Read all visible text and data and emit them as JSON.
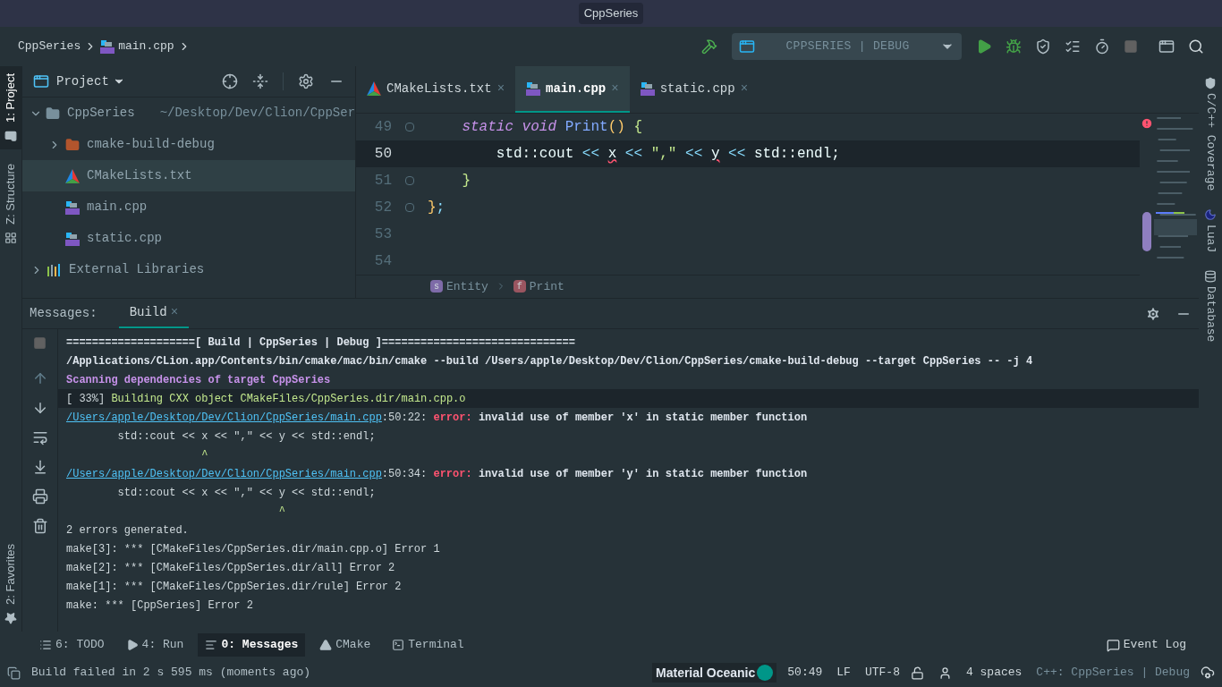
{
  "title_bar": {
    "title": "CppSeries"
  },
  "nav_bar": {
    "breadcrumbs": [
      {
        "label": "CppSeries",
        "kind": "project"
      },
      {
        "label": "main.cpp",
        "kind": "cpp"
      }
    ],
    "run_config": "CPPSERIES | DEBUG"
  },
  "left_stripe": {
    "top": [
      {
        "label": "1: Project",
        "selected": true,
        "kind": "folder"
      },
      {
        "label": "Z: Structure",
        "selected": false,
        "kind": "structure"
      }
    ],
    "bottom": [
      {
        "label": "2: Favorites",
        "selected": false,
        "kind": "star"
      }
    ]
  },
  "project_panel": {
    "title": "Project",
    "tree": [
      {
        "label": "CppSeries",
        "path": "~/Desktop/Dev/Clion/CppSer",
        "kind": "folder",
        "expanded": true,
        "selected": false,
        "children": [
          {
            "label": "cmake-build-debug",
            "kind": "build-folder",
            "expanded": false,
            "selected": false
          },
          {
            "label": "CMakeLists.txt",
            "kind": "cmake",
            "selected": true
          },
          {
            "label": "main.cpp",
            "kind": "cpp",
            "selected": false
          },
          {
            "label": "static.cpp",
            "kind": "cpp",
            "selected": false
          }
        ]
      },
      {
        "label": "External Libraries",
        "kind": "libraries",
        "expanded": false,
        "selected": false
      }
    ]
  },
  "editor": {
    "tabs": [
      {
        "label": "CMakeLists.txt",
        "close": "×",
        "kind": "cmake",
        "selected": false
      },
      {
        "label": "main.cpp",
        "close": "×",
        "kind": "cpp",
        "selected": true
      },
      {
        "label": "static.cpp",
        "close": "×",
        "kind": "cpp",
        "selected": false
      }
    ],
    "lines": [
      {
        "number": "49",
        "current": false,
        "fold_marker": true,
        "tokens": [
          {
            "text": "    static void",
            "kind": "keyword"
          },
          {
            "text": " Print",
            "kind": "function"
          },
          {
            "text": "()",
            "kind": "paren"
          },
          {
            "text": " {",
            "kind": "brace"
          }
        ]
      },
      {
        "number": "50",
        "current": true,
        "fold_marker": false,
        "tokens": [
          {
            "text": "        std::cout ",
            "kind": "plain"
          },
          {
            "text": "<< ",
            "kind": "operator"
          },
          {
            "text": "x",
            "kind": "error"
          },
          {
            "text": " << ",
            "kind": "operator"
          },
          {
            "text": "\",\"",
            "kind": "string"
          },
          {
            "text": " << ",
            "kind": "operator"
          },
          {
            "text": "y",
            "kind": "error"
          },
          {
            "text": " <<",
            "kind": "operator"
          },
          {
            "text": " std::endl;",
            "kind": "plain"
          }
        ]
      },
      {
        "number": "51",
        "current": false,
        "fold_marker": true,
        "tokens": [
          {
            "text": "    }",
            "kind": "brace"
          }
        ]
      },
      {
        "number": "52",
        "current": false,
        "fold_marker": true,
        "tokens": [
          {
            "text": "}",
            "kind": "paren"
          },
          {
            "text": ";",
            "kind": "operator"
          }
        ]
      },
      {
        "number": "53",
        "current": false,
        "fold_marker": false
      },
      {
        "number": "54",
        "current": false,
        "fold_marker": false
      }
    ],
    "breadcrumbs": [
      {
        "badge": "s",
        "label": "Entity",
        "color": "#7e6ba8"
      },
      {
        "badge": "f",
        "label": "Print",
        "color": "#9a5560"
      }
    ]
  },
  "right_stripe": [
    {
      "label": "C/C++ Coverage",
      "kind": "shield"
    },
    {
      "label": "LuaJ",
      "kind": "moon"
    },
    {
      "label": "Database",
      "kind": "database"
    }
  ],
  "messages_panel": {
    "label": "Messages:",
    "tabs": [
      {
        "label": "Build",
        "close": "×",
        "selected": true
      }
    ],
    "output": [
      {
        "highlighted": false,
        "segments": [
          {
            "text": "====================[ Build | CppSeries | Debug ]==============================",
            "kind": "header"
          }
        ]
      },
      {
        "highlighted": false,
        "segments": [
          {
            "text": "/Applications/CLion.app/Contents/bin/cmake/mac/bin/cmake --build /Users/apple/Desktop/Dev/Clion/CppSeries/cmake-build-debug --target CppSeries -- -j 4",
            "kind": "header"
          }
        ]
      },
      {
        "highlighted": false,
        "segments": [
          {
            "text": "Scanning dependencies of target CppSeries",
            "kind": "purple"
          }
        ]
      },
      {
        "highlighted": true,
        "segments": [
          {
            "text": "[ 33%] ",
            "kind": "plain"
          },
          {
            "text": "Building CXX object CMakeFiles/CppSeries.dir/main.cpp.o",
            "kind": "green"
          }
        ]
      },
      {
        "highlighted": false,
        "segments": [
          {
            "text": "/Users/apple/Desktop/Dev/Clion/CppSeries/main.cpp",
            "kind": "link"
          },
          {
            "text": ":50:22: ",
            "kind": "plain"
          },
          {
            "text": "error:",
            "kind": "error"
          },
          {
            "text": " invalid use of member 'x' in static member function",
            "kind": "header"
          }
        ]
      },
      {
        "highlighted": false,
        "segments": [
          {
            "text": "        std::cout << x << \",\" << y << std::endl;",
            "kind": "plain"
          }
        ]
      },
      {
        "highlighted": false,
        "segments": [
          {
            "text": "                     ^",
            "kind": "green"
          }
        ]
      },
      {
        "highlighted": false,
        "segments": [
          {
            "text": "/Users/apple/Desktop/Dev/Clion/CppSeries/main.cpp",
            "kind": "link"
          },
          {
            "text": ":50:34: ",
            "kind": "plain"
          },
          {
            "text": "error:",
            "kind": "error"
          },
          {
            "text": " invalid use of member 'y' in static member function",
            "kind": "header"
          }
        ]
      },
      {
        "highlighted": false,
        "segments": [
          {
            "text": "        std::cout << x << \",\" << y << std::endl;",
            "kind": "plain"
          }
        ]
      },
      {
        "highlighted": false,
        "segments": [
          {
            "text": "                                 ^",
            "kind": "green"
          }
        ]
      },
      {
        "highlighted": false,
        "segments": [
          {
            "text": "2 errors generated.",
            "kind": "plain"
          }
        ]
      },
      {
        "highlighted": false,
        "segments": [
          {
            "text": "make[3]: *** [CMakeFiles/CppSeries.dir/main.cpp.o] Error 1",
            "kind": "plain"
          }
        ]
      },
      {
        "highlighted": false,
        "segments": [
          {
            "text": "make[2]: *** [CMakeFiles/CppSeries.dir/all] Error 2",
            "kind": "plain"
          }
        ]
      },
      {
        "highlighted": false,
        "segments": [
          {
            "text": "make[1]: *** [CMakeFiles/CppSeries.dir/rule] Error 2",
            "kind": "plain"
          }
        ]
      },
      {
        "highlighted": false,
        "segments": [
          {
            "text": "make: *** [CppSeries] Error 2",
            "kind": "plain"
          }
        ]
      }
    ]
  },
  "tool_tabs": [
    {
      "label": "6: TODO",
      "kind": "list",
      "selected": false
    },
    {
      "label": "4: Run",
      "kind": "run",
      "selected": false
    },
    {
      "label": "0: Messages",
      "kind": "messages",
      "selected": true
    },
    {
      "label": "CMake",
      "kind": "cmake",
      "selected": false
    },
    {
      "label": "Terminal",
      "kind": "terminal",
      "selected": false
    }
  ],
  "event_log": "Event Log",
  "status_bar": {
    "message": "Build failed in 2 s 595 ms (moments ago)",
    "theme": "Material Oceanic",
    "position": "50:49",
    "line_separator": "LF",
    "encoding": "UTF-8",
    "indent": "4 spaces",
    "context": "C++: CppSeries | Debug"
  }
}
